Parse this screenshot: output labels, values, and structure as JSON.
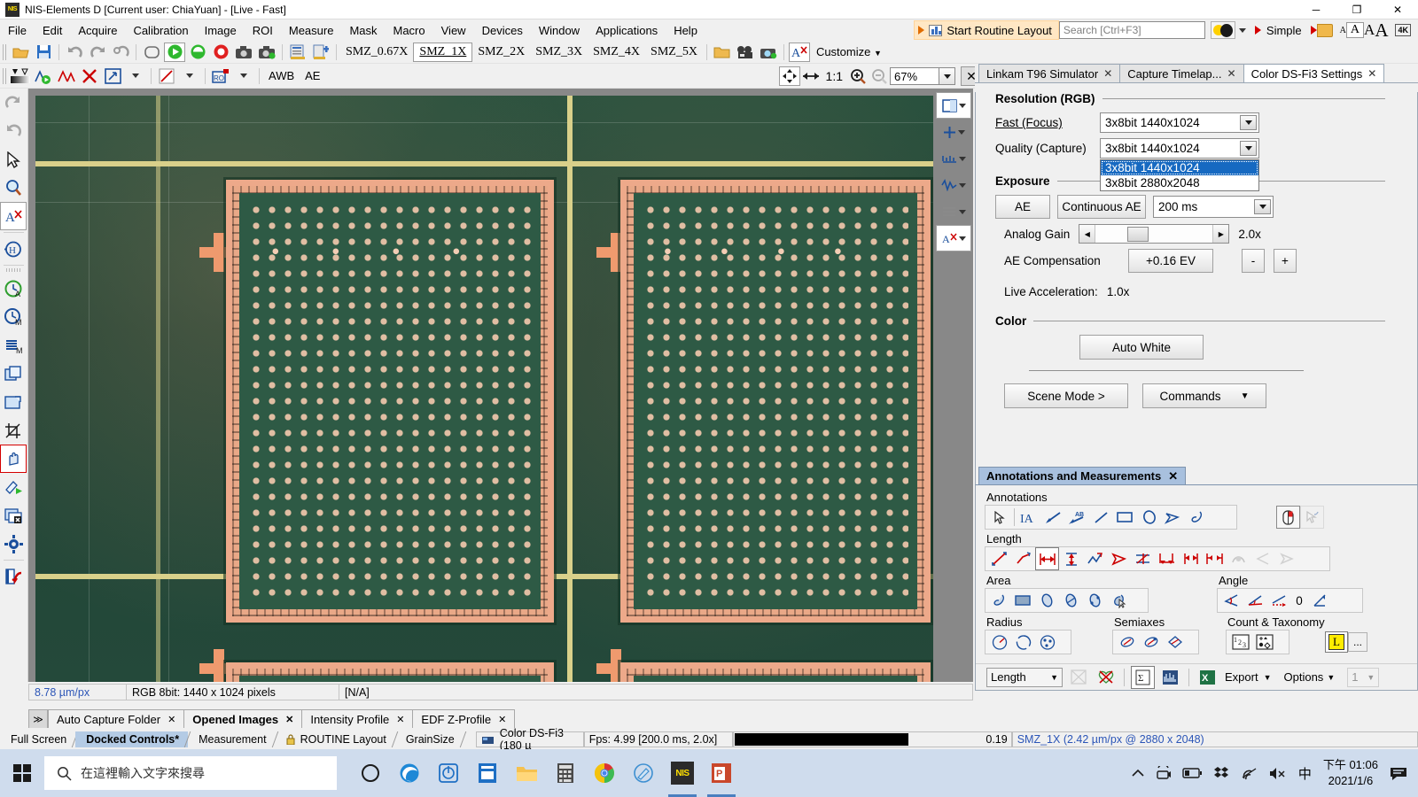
{
  "window": {
    "title": "NIS-Elements D [Current user: ChiaYuan]  - [Live - Fast]",
    "app_icon": "NIS",
    "minimize": "─",
    "maximize": "❐",
    "close": "✕"
  },
  "menu": {
    "items": [
      "File",
      "Edit",
      "Acquire",
      "Calibration",
      "Image",
      "ROI",
      "Measure",
      "Mask",
      "Macro",
      "View",
      "Devices",
      "Window",
      "Applications",
      "Help"
    ]
  },
  "menu_right": {
    "routine_label": "Start Routine Layout",
    "search_placeholder": "Search [Ctrl+F3]",
    "simple_label": "Simple",
    "font_sizes": [
      "A",
      "A",
      "A",
      "A"
    ],
    "res_badge": "4K"
  },
  "toolbar": {
    "magnifications": [
      "SMZ_0.67X",
      "SMZ_1X",
      "SMZ_2X",
      "SMZ_3X",
      "SMZ_4X",
      "SMZ_5X"
    ],
    "active_magnification": "SMZ_1X",
    "customize_label": "Customize",
    "awb_label": "AWB",
    "ae_label": "AE"
  },
  "zoom_toolbar": {
    "fit_label": "fit-icon",
    "width_label": "fit-width-icon",
    "one_to_one": "1:1",
    "zoom_in": "zoom-in-icon",
    "zoom_out": "zoom-out-icon",
    "zoom_value": "67%",
    "close": "✕"
  },
  "right_panel": {
    "tabs": [
      {
        "label": "Linkam T96 Simulator",
        "active": false
      },
      {
        "label": "Capture Timelap...",
        "active": false
      },
      {
        "label": "Color DS-Fi3 Settings",
        "active": true
      }
    ],
    "resolution": {
      "group_title": "Resolution (RGB)",
      "fast_label": "Fast (Focus)",
      "fast_value": "3x8bit 1440x1024",
      "quality_label": "Quality (Capture)",
      "quality_value": "3x8bit 1440x1024",
      "dropdown_open": true,
      "options": [
        "3x8bit 1440x1024",
        "3x8bit 2880x2048"
      ],
      "selected_option": "3x8bit 1440x1024"
    },
    "exposure": {
      "group_title": "Exposure",
      "ae_button": "AE",
      "continuous_ae_button": "Continuous AE",
      "exposure_value": "200 ms",
      "analog_gain_label": "Analog Gain",
      "analog_gain_value": "2.0x",
      "ae_compensation_label": "AE Compensation",
      "ae_compensation_value": "+0.16 EV",
      "minus_button": "-",
      "plus_button": "+",
      "live_acceleration_label": "Live Acceleration:",
      "live_acceleration_value": "1.0x"
    },
    "color": {
      "group_title": "Color",
      "auto_white_button": "Auto White"
    },
    "footer": {
      "scene_mode_button": "Scene Mode >",
      "commands_button": "Commands"
    }
  },
  "annotations_panel": {
    "tab_label": "Annotations and Measurements",
    "tab_close": "✕",
    "sections": {
      "annotations": "Annotations",
      "length": "Length",
      "area": "Area",
      "angle": "Angle",
      "radius": "Radius",
      "semiaxes": "Semiaxes",
      "count_taxonomy": "Count & Taxonomy"
    },
    "angle_count": "0",
    "taxonomy_letter": "L",
    "taxonomy_more": "...",
    "bottom_bar": {
      "measure_type": "Length",
      "export_label": "Export",
      "options_label": "Options",
      "page_value": "1"
    }
  },
  "image_status": {
    "scale": "8.78 µm/px",
    "format": "RGB 8bit: 1440 x 1024 pixels",
    "na": "[N/A]"
  },
  "dock_tabs": [
    {
      "label": "Auto Capture Folder",
      "bold": false
    },
    {
      "label": "Opened Images",
      "bold": true
    },
    {
      "label": "Intensity Profile",
      "bold": false
    },
    {
      "label": "EDF Z-Profile",
      "bold": false
    }
  ],
  "status_bar": {
    "tabs": [
      {
        "label": "Full Screen",
        "active": false,
        "lock": false
      },
      {
        "label": "Docked Controls*",
        "active": true,
        "lock": false
      },
      {
        "label": "Measurement",
        "active": false,
        "lock": false
      },
      {
        "label": "ROUTINE Layout",
        "active": false,
        "lock": true
      },
      {
        "label": "GrainSize",
        "active": false,
        "lock": false
      }
    ],
    "camera": "Color DS-Fi3 (180 µ",
    "fps": "Fps: 4.99 [200.0 ms, 2.0x]",
    "histogram_value": "0.19",
    "objective": "SMZ_1X (2.42 µm/px @ 2880 x 2048)"
  },
  "taskbar": {
    "search_placeholder": "在這裡輸入文字來搜尋",
    "apps": [
      "cortana-icon",
      "edge-icon",
      "app-ring-icon",
      "window-app-icon",
      "file-explorer-icon",
      "calculator-icon",
      "chrome-icon",
      "paint-icon",
      "nis-elements-icon",
      "powerpoint-icon"
    ],
    "tray_icons": [
      "chevron-up-icon",
      "camera-tray-icon",
      "battery-icon",
      "dropbox-icon",
      "wifi-icon",
      "mute-icon"
    ],
    "ime": "中",
    "time": "下午 01:06",
    "date": "2021/1/6",
    "notification": "notification-icon"
  },
  "colors": {
    "accent_blue": "#1669c1",
    "tab_blue": "#a8c0de",
    "orange": "#e06c00",
    "taskbar": "#cfdced"
  }
}
